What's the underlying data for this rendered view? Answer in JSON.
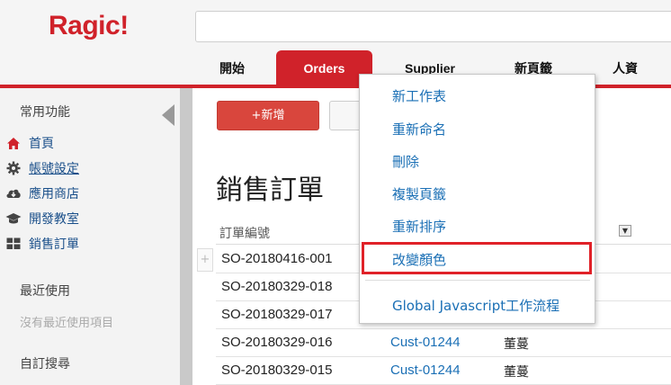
{
  "header": {
    "logo": "Ragic!",
    "search_placeholder": "",
    "tabs": [
      {
        "label": "開始"
      },
      {
        "label": "Orders"
      },
      {
        "label": "Supplier"
      },
      {
        "label": "新頁籤"
      },
      {
        "label": "人資"
      }
    ],
    "active_tab": "Orders"
  },
  "sidebar": {
    "favorites_title": "常用功能",
    "items": [
      {
        "label": "首頁",
        "icon": "home-icon"
      },
      {
        "label": "帳號設定",
        "icon": "gear-icon"
      },
      {
        "label": "應用商店",
        "icon": "cloud-download-icon"
      },
      {
        "label": "開發教室",
        "icon": "graduation-cap-icon"
      },
      {
        "label": "銷售訂單",
        "icon": "grid-icon"
      }
    ],
    "recent_title": "最近使用",
    "recent_empty": "沒有最近使用項目",
    "custom_search_title": "自訂搜尋"
  },
  "main": {
    "new_button": "+新增",
    "title": "銷售訂單",
    "column_header": "訂單編號",
    "rows": [
      {
        "order_no": "SO-20180416-001",
        "customer": "",
        "name": ""
      },
      {
        "order_no": "SO-20180329-018",
        "customer": "",
        "name": ""
      },
      {
        "order_no": "SO-20180329-017",
        "customer": "",
        "name": ""
      },
      {
        "order_no": "SO-20180329-016",
        "customer": "Cust-01244",
        "name": "董蔓"
      },
      {
        "order_no": "SO-20180329-015",
        "customer": "Cust-01244",
        "name": "董蔓"
      }
    ],
    "plus_label": "+"
  },
  "tab_menu": {
    "items": [
      {
        "label": "新工作表"
      },
      {
        "label": "重新命名"
      },
      {
        "label": "刪除"
      },
      {
        "label": "複製頁籤"
      },
      {
        "label": "重新排序"
      },
      {
        "label": "改變顏色"
      },
      {
        "label": "Global Javascript工作流程"
      }
    ],
    "highlighted": "改變顏色"
  },
  "colors": {
    "brand_red": "#d0222a",
    "link_blue": "#1a6fb5",
    "highlight_border": "#e02128"
  }
}
